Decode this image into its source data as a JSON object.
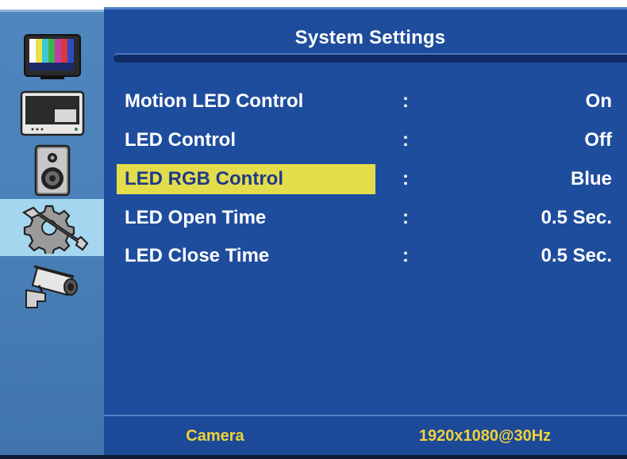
{
  "title": "System Settings",
  "menu": [
    {
      "label": "Motion LED Control",
      "separator": ":",
      "value": "On",
      "selected": false
    },
    {
      "label": "LED Control",
      "separator": ":",
      "value": "Off",
      "selected": false
    },
    {
      "label": "LED RGB Control",
      "separator": ":",
      "value": "Blue",
      "selected": true
    },
    {
      "label": "LED Open Time",
      "separator": ":",
      "value": "0.5 Sec.",
      "selected": false
    },
    {
      "label": "LED Close Time",
      "separator": ":",
      "value": "0.5 Sec.",
      "selected": false
    }
  ],
  "sidebar": {
    "items": [
      {
        "icon": "tv-color-bars-icon",
        "selected": false
      },
      {
        "icon": "monitor-display-icon",
        "selected": false
      },
      {
        "icon": "speaker-icon",
        "selected": false
      },
      {
        "icon": "settings-wrench-gear-icon",
        "selected": true
      },
      {
        "icon": "security-camera-icon",
        "selected": false
      }
    ]
  },
  "footer": {
    "source": "Camera",
    "resolution": "1920x1080@30Hz"
  },
  "colors": {
    "panel": "#1f4d9e",
    "highlight": "#e3dd4c",
    "footer_text": "#f0d23a",
    "rail": "#4a80b8",
    "rail_selected": "#a5d6ef"
  }
}
